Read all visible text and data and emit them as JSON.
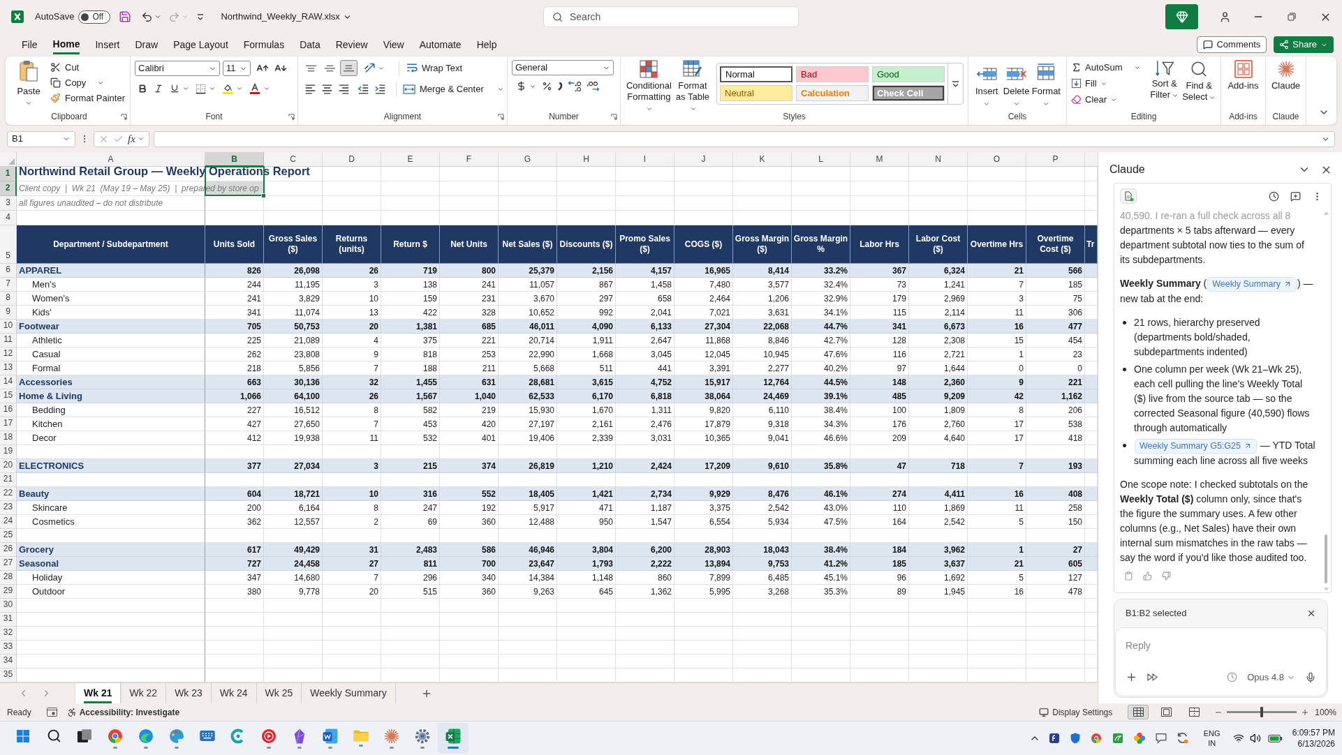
{
  "title_bar": {
    "autosave": {
      "label": "AutoSave",
      "state_label": "Off",
      "on": false
    },
    "file_name": "Northwind_Weekly_RAW.xlsx",
    "search": {
      "placeholder": "Search"
    }
  },
  "menu_tabs": [
    {
      "label": "File",
      "selected": false
    },
    {
      "label": "Home",
      "selected": true
    },
    {
      "label": "Insert",
      "selected": false
    },
    {
      "label": "Draw",
      "selected": false
    },
    {
      "label": "Page Layout",
      "selected": false
    },
    {
      "label": "Formulas",
      "selected": false
    },
    {
      "label": "Data",
      "selected": false
    },
    {
      "label": "Review",
      "selected": false
    },
    {
      "label": "View",
      "selected": false
    },
    {
      "label": "Automate",
      "selected": false
    },
    {
      "label": "Help",
      "selected": false
    }
  ],
  "header_buttons": [
    {
      "kind": "comments",
      "label": "Comments"
    },
    {
      "kind": "share",
      "label": "Share"
    }
  ],
  "ribbon": [
    {
      "kind": "clipboard",
      "label": "Clipboard",
      "paste": "Paste",
      "actions": [
        {
          "kind": "cut",
          "label": "Cut"
        },
        {
          "kind": "copy",
          "label": "Copy"
        },
        {
          "kind": "format_painter",
          "label": "Format Painter"
        }
      ]
    },
    {
      "kind": "font",
      "label": "Font",
      "font_name": "Calibri",
      "font_size": "11"
    },
    {
      "kind": "alignment",
      "label": "Alignment",
      "wrap_text": "Wrap Text",
      "merge": "Merge & Center",
      "vertical_options": [
        {
          "kind": "top",
          "selected": false
        },
        {
          "kind": "middle",
          "selected": false
        },
        {
          "kind": "bottom",
          "selected": true
        }
      ]
    },
    {
      "kind": "number",
      "label": "Number",
      "format": "General"
    },
    {
      "kind": "styles",
      "label": "Styles",
      "buttons": [
        "Conditional Formatting",
        "Format as Table"
      ],
      "cell_styles": [
        {
          "kind": "normal",
          "label": "Normal",
          "selected": true
        },
        {
          "kind": "bad",
          "label": "Bad",
          "selected": false
        },
        {
          "kind": "good",
          "label": "Good",
          "selected": false
        },
        {
          "kind": "neutral",
          "label": "Neutral",
          "selected": false
        },
        {
          "kind": "calculation",
          "label": "Calculation",
          "selected": false
        },
        {
          "kind": "check",
          "label": "Check Cell",
          "selected": false
        }
      ]
    },
    {
      "kind": "cells",
      "label": "Cells",
      "buttons": [
        {
          "kind": "insert",
          "label": "Insert"
        },
        {
          "kind": "delete",
          "label": "Delete"
        },
        {
          "kind": "format",
          "label": "Format"
        }
      ]
    },
    {
      "kind": "editing",
      "label": "Editing",
      "actions": [
        {
          "kind": "autosum",
          "label": "AutoSum"
        },
        {
          "kind": "fill",
          "label": "Fill"
        },
        {
          "kind": "clear",
          "label": "Clear"
        }
      ],
      "buttons": [
        {
          "kind": "sort",
          "label": "Sort & Filter"
        },
        {
          "kind": "find",
          "label": "Find & Select"
        }
      ]
    },
    {
      "kind": "addins",
      "label": "Add-ins",
      "button": "Add-ins"
    },
    {
      "kind": "claude",
      "label": "Claude",
      "button": "Claude"
    }
  ],
  "formula_bar": {
    "name_box": "B1",
    "function_label": "fx"
  },
  "sheet": {
    "columns": [
      {
        "letter": "A",
        "selected": false
      },
      {
        "letter": "B",
        "selected": true
      },
      {
        "letter": "C",
        "selected": false
      },
      {
        "letter": "D",
        "selected": false
      },
      {
        "letter": "E",
        "selected": false
      },
      {
        "letter": "F",
        "selected": false
      },
      {
        "letter": "G",
        "selected": false
      },
      {
        "letter": "H",
        "selected": false
      },
      {
        "letter": "I",
        "selected": false
      },
      {
        "letter": "J",
        "selected": false
      },
      {
        "letter": "K",
        "selected": false
      },
      {
        "letter": "L",
        "selected": false
      },
      {
        "letter": "M",
        "selected": false
      },
      {
        "letter": "N",
        "selected": false
      },
      {
        "letter": "O",
        "selected": false
      },
      {
        "letter": "P",
        "selected": false
      }
    ],
    "rows": [
      {
        "number": "1",
        "selected": true,
        "kind": "title",
        "text": "Northwind Retail Group — Weekly Operations Report"
      },
      {
        "number": "2",
        "selected": true,
        "kind": "subtitle",
        "text": "Client copy  |  Wk 21  (May 19 – May 25)  |  prepared by store op"
      },
      {
        "number": "3",
        "selected": false,
        "kind": "note",
        "text": "all figures unaudited – do not distribute"
      },
      {
        "number": "4",
        "selected": false,
        "kind": "blank"
      },
      {
        "number": "5",
        "selected": false,
        "kind": "header",
        "cells": [
          "Department / Subdepartment",
          "Units Sold",
          "Gross Sales ($)",
          "Returns (units)",
          "Return $",
          "Net Units",
          "Net Sales ($)",
          "Discounts ($)",
          "Promo Sales ($)",
          "COGS ($)",
          "Gross Margin ($)",
          "Gross Margin %",
          "Labor Hrs",
          "Labor Cost ($)",
          "Overtime Hrs",
          "Overtime Cost ($)",
          "Tr"
        ]
      },
      {
        "number": "6",
        "selected": false,
        "kind": "department",
        "label": "APPAREL",
        "values": [
          "826",
          "26,098",
          "26",
          "719",
          "800",
          "25,379",
          "2,156",
          "4,157",
          "16,965",
          "8,414",
          "33.2%",
          "367",
          "6,324",
          "21",
          "566"
        ]
      },
      {
        "number": "7",
        "selected": false,
        "kind": "subdepartment",
        "label": "Men's",
        "values": [
          "244",
          "11,195",
          "3",
          "138",
          "241",
          "11,057",
          "867",
          "1,458",
          "7,480",
          "3,577",
          "32.4%",
          "73",
          "1,241",
          "7",
          "185"
        ]
      },
      {
        "number": "8",
        "selected": false,
        "kind": "subdepartment",
        "label": "Women's",
        "values": [
          "241",
          "3,829",
          "10",
          "159",
          "231",
          "3,670",
          "297",
          "658",
          "2,464",
          "1,206",
          "32.9%",
          "179",
          "2,969",
          "3",
          "75"
        ]
      },
      {
        "number": "9",
        "selected": false,
        "kind": "subdepartment",
        "label": "Kids'",
        "values": [
          "341",
          "11,074",
          "13",
          "422",
          "328",
          "10,652",
          "992",
          "2,041",
          "7,021",
          "3,631",
          "34.1%",
          "115",
          "2,114",
          "11",
          "306"
        ]
      },
      {
        "number": "10",
        "selected": false,
        "kind": "department",
        "label": "Footwear",
        "values": [
          "705",
          "50,753",
          "20",
          "1,381",
          "685",
          "46,011",
          "4,090",
          "6,133",
          "27,304",
          "22,068",
          "44.7%",
          "341",
          "6,673",
          "16",
          "477"
        ]
      },
      {
        "number": "11",
        "selected": false,
        "kind": "subdepartment",
        "label": "Athletic",
        "values": [
          "225",
          "21,089",
          "4",
          "375",
          "221",
          "20,714",
          "1,911",
          "2,647",
          "11,868",
          "8,846",
          "42.7%",
          "128",
          "2,308",
          "15",
          "454"
        ]
      },
      {
        "number": "12",
        "selected": false,
        "kind": "subdepartment",
        "label": "Casual",
        "values": [
          "262",
          "23,808",
          "9",
          "818",
          "253",
          "22,990",
          "1,668",
          "3,045",
          "12,045",
          "10,945",
          "47.6%",
          "116",
          "2,721",
          "1",
          "23"
        ]
      },
      {
        "number": "13",
        "selected": false,
        "kind": "subdepartment",
        "label": "Formal",
        "values": [
          "218",
          "5,856",
          "7",
          "188",
          "211",
          "5,668",
          "511",
          "441",
          "3,391",
          "2,277",
          "40.2%",
          "97",
          "1,644",
          "0",
          "0"
        ]
      },
      {
        "number": "14",
        "selected": false,
        "kind": "department",
        "label": "Accessories",
        "values": [
          "663",
          "30,136",
          "32",
          "1,455",
          "631",
          "28,681",
          "3,615",
          "4,752",
          "15,917",
          "12,764",
          "44.5%",
          "148",
          "2,360",
          "9",
          "221"
        ]
      },
      {
        "number": "15",
        "selected": false,
        "kind": "department",
        "label": "Home & Living",
        "values": [
          "1,066",
          "64,100",
          "26",
          "1,567",
          "1,040",
          "62,533",
          "6,170",
          "6,818",
          "38,064",
          "24,469",
          "39.1%",
          "485",
          "9,209",
          "42",
          "1,162"
        ]
      },
      {
        "number": "16",
        "selected": false,
        "kind": "subdepartment",
        "label": "Bedding",
        "values": [
          "227",
          "16,512",
          "8",
          "582",
          "219",
          "15,930",
          "1,670",
          "1,311",
          "9,820",
          "6,110",
          "38.4%",
          "100",
          "1,809",
          "8",
          "206"
        ]
      },
      {
        "number": "17",
        "selected": false,
        "kind": "subdepartment",
        "label": "Kitchen",
        "values": [
          "427",
          "27,650",
          "7",
          "453",
          "420",
          "27,197",
          "2,161",
          "2,476",
          "17,879",
          "9,318",
          "34.3%",
          "176",
          "2,760",
          "17",
          "538"
        ]
      },
      {
        "number": "18",
        "selected": false,
        "kind": "subdepartment",
        "label": "Decor",
        "values": [
          "412",
          "19,938",
          "11",
          "532",
          "401",
          "19,406",
          "2,339",
          "3,031",
          "10,365",
          "9,041",
          "46.6%",
          "209",
          "4,640",
          "17",
          "418"
        ]
      },
      {
        "number": "19",
        "selected": false,
        "kind": "blank"
      },
      {
        "number": "20",
        "selected": false,
        "kind": "department",
        "label": "ELECTRONICS",
        "values": [
          "377",
          "27,034",
          "3",
          "215",
          "374",
          "26,819",
          "1,210",
          "2,424",
          "17,209",
          "9,610",
          "35.8%",
          "47",
          "718",
          "7",
          "193"
        ]
      },
      {
        "number": "21",
        "selected": false,
        "kind": "blank"
      },
      {
        "number": "22",
        "selected": false,
        "kind": "department",
        "label": "Beauty",
        "values": [
          "604",
          "18,721",
          "10",
          "316",
          "552",
          "18,405",
          "1,421",
          "2,734",
          "9,929",
          "8,476",
          "46.1%",
          "274",
          "4,411",
          "16",
          "408"
        ]
      },
      {
        "number": "23",
        "selected": false,
        "kind": "subdepartment",
        "label": "Skincare",
        "values": [
          "200",
          "6,164",
          "8",
          "247",
          "192",
          "5,917",
          "471",
          "1,187",
          "3,375",
          "2,542",
          "43.0%",
          "110",
          "1,869",
          "11",
          "258"
        ]
      },
      {
        "number": "24",
        "selected": false,
        "kind": "subdepartment",
        "label": "Cosmetics",
        "values": [
          "362",
          "12,557",
          "2",
          "69",
          "360",
          "12,488",
          "950",
          "1,547",
          "6,554",
          "5,934",
          "47.5%",
          "164",
          "2,542",
          "5",
          "150"
        ]
      },
      {
        "number": "25",
        "selected": false,
        "kind": "blank"
      },
      {
        "number": "26",
        "selected": false,
        "kind": "department",
        "label": "Grocery",
        "values": [
          "617",
          "49,429",
          "31",
          "2,483",
          "586",
          "46,946",
          "3,804",
          "6,200",
          "28,903",
          "18,043",
          "38.4%",
          "184",
          "3,962",
          "1",
          "27"
        ]
      },
      {
        "number": "27",
        "selected": false,
        "kind": "department",
        "label": "Seasonal",
        "values": [
          "727",
          "24,458",
          "27",
          "811",
          "700",
          "23,647",
          "1,793",
          "2,222",
          "13,894",
          "9,753",
          "41.2%",
          "185",
          "3,637",
          "21",
          "605"
        ]
      },
      {
        "number": "28",
        "selected": false,
        "kind": "subdepartment",
        "label": "Holiday",
        "values": [
          "347",
          "14,680",
          "7",
          "296",
          "340",
          "14,384",
          "1,148",
          "860",
          "7,899",
          "6,485",
          "45.1%",
          "96",
          "1,692",
          "5",
          "127"
        ]
      },
      {
        "number": "29",
        "selected": false,
        "kind": "subdepartment",
        "label": "Outdoor",
        "values": [
          "380",
          "9,778",
          "20",
          "515",
          "360",
          "9,263",
          "645",
          "1,362",
          "5,995",
          "3,268",
          "35.3%",
          "89",
          "1,945",
          "16",
          "478"
        ]
      },
      {
        "number": "30",
        "selected": false,
        "kind": "blank"
      },
      {
        "number": "31",
        "selected": false,
        "kind": "blank"
      },
      {
        "number": "32",
        "selected": false,
        "kind": "blank"
      },
      {
        "number": "33",
        "selected": false,
        "kind": "blank"
      },
      {
        "number": "34",
        "selected": false,
        "kind": "blank"
      },
      {
        "number": "35",
        "selected": false,
        "kind": "blank"
      }
    ]
  },
  "sheet_tabs": [
    {
      "label": "Wk 21",
      "selected": true
    },
    {
      "label": "Wk 22",
      "selected": false
    },
    {
      "label": "Wk 23",
      "selected": false
    },
    {
      "label": "Wk 24",
      "selected": false
    },
    {
      "label": "Wk 25",
      "selected": false
    },
    {
      "label": "Weekly Summary",
      "selected": false
    }
  ],
  "claude_panel": {
    "title": "Claude",
    "messages": [
      {
        "kind": "paragraph",
        "parts": [
          {
            "kind": "text",
            "text": "40,590. I re-ran a full check across all 8 departments × 5 tabs afterward — every department subtotal now ties to the sum of its subdepartments."
          }
        ]
      },
      {
        "kind": "paragraph",
        "parts": [
          {
            "kind": "text",
            "text": "**Weekly Summary** ("
          },
          {
            "kind": "link",
            "text": "Weekly Summary"
          },
          {
            "kind": "text",
            "text": ") — new tab at the end:"
          }
        ]
      },
      {
        "kind": "bullets",
        "items": [
          {
            "parts": [
              {
                "kind": "text",
                "text": "21 rows, hierarchy preserved (departments bold/shaded, subdepartments indented)"
              }
            ]
          },
          {
            "parts": [
              {
                "kind": "text",
                "text": "One column per week (Wk 21–Wk 25), each cell pulling the line's Weekly Total ($) live from the source tab — so the corrected Seasonal figure (40,590) flows through automatically"
              }
            ]
          },
          {
            "parts": [
              {
                "kind": "link",
                "text": "Weekly Summary G5:G25"
              },
              {
                "kind": "text",
                "text": " — YTD Total summing each line across all five weeks"
              }
            ]
          }
        ]
      },
      {
        "kind": "paragraph",
        "parts": [
          {
            "kind": "text",
            "text": "One scope note: I checked subtotals on the **Weekly Total ($)** column only, since that's the figure the summary uses. A few other columns (e.g., Net Sales) have their own internal sum mismatches in the raw tabs — say the word if you'd like those audited too."
          }
        ]
      }
    ],
    "context": "B1:B2 selected",
    "reply": {
      "placeholder": "Reply"
    },
    "model": "Opus 4.8"
  },
  "status_bar": {
    "status": "Ready",
    "accessibility": "Accessibility: Investigate",
    "display_settings": "Display Settings",
    "views": [
      {
        "kind": "normal",
        "selected": true
      },
      {
        "kind": "page_layout",
        "selected": false
      },
      {
        "kind": "page_break",
        "selected": false
      }
    ],
    "zoom": {
      "level": 0.5,
      "label": "100%"
    }
  },
  "taskbar": {
    "apps": [
      {
        "kind": "start",
        "running": false,
        "selected": false
      },
      {
        "kind": "search",
        "running": false,
        "selected": false
      },
      {
        "kind": "task_view",
        "running": false,
        "selected": false
      },
      {
        "kind": "browser",
        "running": true,
        "selected": false
      },
      {
        "kind": "wave",
        "running": true,
        "selected": false
      },
      {
        "kind": "palette",
        "running": true,
        "selected": false
      },
      {
        "kind": "keyboard",
        "running": false,
        "selected": false
      },
      {
        "kind": "ring",
        "running": false,
        "selected": false
      },
      {
        "kind": "play",
        "running": true,
        "selected": false
      },
      {
        "kind": "crystal",
        "running": true,
        "selected": false
      },
      {
        "kind": "document",
        "running": true,
        "selected": false
      },
      {
        "kind": "folder",
        "running": true,
        "selected": false
      },
      {
        "kind": "asterisk",
        "running": true,
        "selected": false
      },
      {
        "kind": "gear",
        "running": true,
        "selected": false
      },
      {
        "kind": "spreadsheet",
        "running": true,
        "selected": true
      }
    ],
    "language": [
      "ENG",
      "IN"
    ],
    "time": "6:09:57 PM",
    "date": "6/13/2026"
  }
}
